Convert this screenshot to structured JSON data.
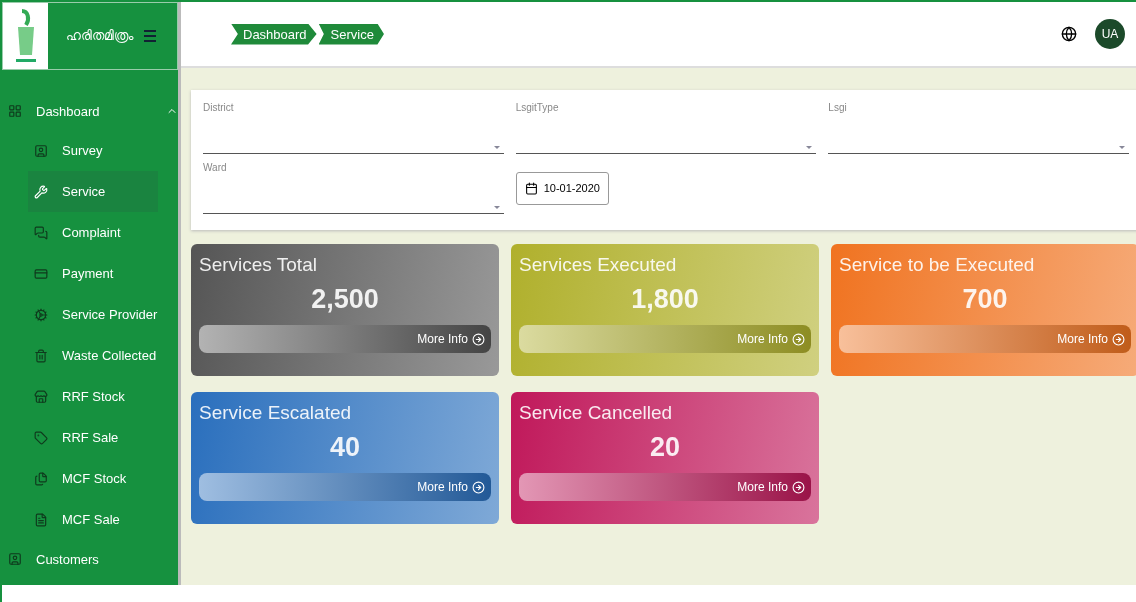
{
  "brand": {
    "name": "ഹരിതമിത്രം"
  },
  "breadcrumbs": [
    "Dashboard",
    "Service"
  ],
  "user": {
    "initials": "UA"
  },
  "sidebar": {
    "items": [
      {
        "label": "Dashboard",
        "expanded": true,
        "children": [
          {
            "label": "Survey",
            "selected": false
          },
          {
            "label": "Service",
            "selected": true
          },
          {
            "label": "Complaint",
            "selected": false
          },
          {
            "label": "Payment",
            "selected": false
          },
          {
            "label": "Service Provider",
            "selected": false
          },
          {
            "label": "Waste Collected",
            "selected": false
          },
          {
            "label": "RRF Stock",
            "selected": false
          },
          {
            "label": "RRF Sale",
            "selected": false
          },
          {
            "label": "MCF Stock",
            "selected": false
          },
          {
            "label": "MCF Sale",
            "selected": false
          }
        ]
      },
      {
        "label": "Customers"
      }
    ]
  },
  "filters": [
    {
      "kind": "select",
      "label": "District"
    },
    {
      "kind": "select",
      "label": "LsgitType"
    },
    {
      "kind": "select",
      "label": "Lsgi"
    },
    {
      "kind": "select",
      "label": "Ward"
    },
    {
      "kind": "date",
      "value": "10-01-2020"
    }
  ],
  "cards": [
    {
      "title": "Services Total",
      "value": "2,500",
      "link": "More Info",
      "color": "#555555"
    },
    {
      "title": "Services Executed",
      "value": "1,800",
      "link": "More Info",
      "color": "#b0b02c"
    },
    {
      "title": "Service to be Executed",
      "value": "700",
      "link": "More Info",
      "color": "#f07320"
    },
    {
      "title": "Service Escalated",
      "value": "40",
      "link": "More Info",
      "color": "#2a6fbd"
    },
    {
      "title": "Service Cancelled",
      "value": "20",
      "link": "More Info",
      "color": "#c0185a"
    }
  ]
}
